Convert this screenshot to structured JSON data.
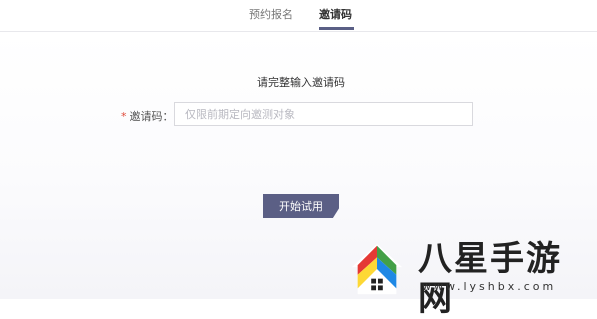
{
  "tabs": [
    {
      "label": "预约报名",
      "active": false
    },
    {
      "label": "邀请码",
      "active": true
    }
  ],
  "form": {
    "prompt": "请完整输入邀请码",
    "required_mark": "*",
    "field_label": "邀请码：",
    "input_value": "",
    "input_placeholder": "仅限前期定向邀测对象",
    "submit_label": "开始试用"
  },
  "colors": {
    "accent": "#5b5f85",
    "required": "#e04a3a"
  },
  "watermark": {
    "text": "八星手游网",
    "url": "www.lyshbx.com"
  }
}
